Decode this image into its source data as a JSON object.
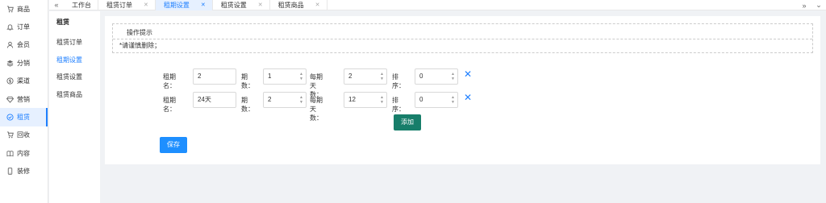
{
  "sidebar": {
    "items": [
      {
        "label": "商品",
        "icon": "cart-icon"
      },
      {
        "label": "订单",
        "icon": "bell-icon"
      },
      {
        "label": "会员",
        "icon": "user-icon"
      },
      {
        "label": "分销",
        "icon": "layers-icon"
      },
      {
        "label": "渠道",
        "icon": "dollar-icon"
      },
      {
        "label": "营销",
        "icon": "diamond-icon"
      },
      {
        "label": "租赁",
        "icon": "check-circle-icon"
      },
      {
        "label": "回收",
        "icon": "cart-icon"
      },
      {
        "label": "内容",
        "icon": "book-icon"
      },
      {
        "label": "装修",
        "icon": "phone-icon"
      }
    ],
    "active_index": 6
  },
  "submenu": {
    "title": "租赁",
    "items": [
      "租赁订单",
      "租期设置",
      "租赁设置",
      "租赁商品"
    ],
    "active_index": 1
  },
  "tabs": {
    "items": [
      {
        "label": "工作台",
        "closable": false
      },
      {
        "label": "租赁订单",
        "closable": true
      },
      {
        "label": "租期设置",
        "closable": true
      },
      {
        "label": "租赁设置",
        "closable": true
      },
      {
        "label": "租赁商品",
        "closable": true
      }
    ],
    "active_index": 2
  },
  "tips": {
    "title": "操作提示",
    "text": "*请谨慎删除；"
  },
  "form": {
    "labels": {
      "name": "租期名：",
      "periods": "期数：",
      "days": "每期天数：",
      "sort": "排序："
    },
    "rows": [
      {
        "name": "2",
        "periods": "1",
        "days": "2",
        "sort": "0"
      },
      {
        "name": "24天",
        "periods": "2",
        "days": "12",
        "sort": "0"
      }
    ],
    "add_label": "添加",
    "save_label": "保存"
  },
  "colors": {
    "accent": "#1e7fff",
    "add_button": "#177e6a",
    "save_button": "#1e8fff"
  }
}
